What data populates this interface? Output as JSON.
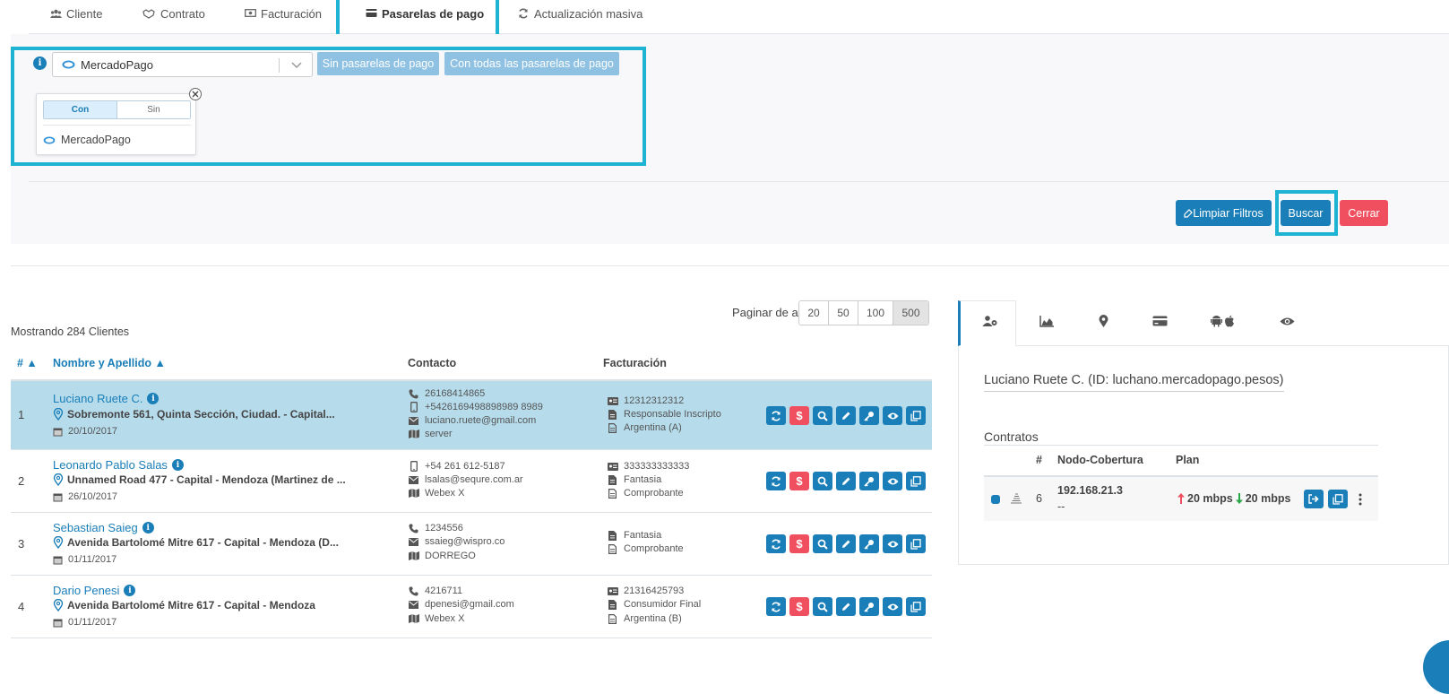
{
  "tabs": [
    {
      "label": "Cliente"
    },
    {
      "label": "Contrato"
    },
    {
      "label": "Facturación"
    },
    {
      "label": "Pasarelas de pago"
    },
    {
      "label": "Actualización masiva"
    }
  ],
  "filter": {
    "selected_gateway": "MercadoPago",
    "btn_without": "Sin pasarelas de pago",
    "btn_all": "Con todas las pasarelas de pago",
    "toggle_on": "Con",
    "toggle_off": "Sin",
    "option": "MercadoPago"
  },
  "actions": {
    "clear": "Limpiar Filtros",
    "search": "Buscar",
    "close": "Cerrar"
  },
  "pagination": {
    "label": "Paginar de a",
    "options": [
      "20",
      "50",
      "100",
      "500"
    ],
    "selected": "500"
  },
  "count_text": "Mostrando 284 Clientes",
  "table": {
    "headers": {
      "num": "# ▲",
      "name": "Nombre y Apellido ▲",
      "contact": "Contacto",
      "billing": "Facturación"
    },
    "rows": [
      {
        "num": "1",
        "name": "Luciano Ruete C.",
        "address": "Sobremonte 561, Quinta Sección, Ciudad. - Capital...",
        "date": "20/10/2017",
        "phone": "26168414865",
        "mobile": "+5426169498898989 8989",
        "email": "luciano.ruete@gmail.com",
        "node": "server",
        "doc": "12312312312",
        "tax": "Responsable Inscripto",
        "invoice": "Argentina (A)"
      },
      {
        "num": "2",
        "name": "Leonardo Pablo Salas",
        "address": "Unnamed Road 477 - Capital - Mendoza (Martinez de ...",
        "date": "26/10/2017",
        "mobile": "+54 261 612-5187",
        "email": "lsalas@sequre.com.ar",
        "node": "Webex X",
        "doc": "333333333333",
        "tax": "Fantasia",
        "invoice": "Comprobante"
      },
      {
        "num": "3",
        "name": "Sebastian Saieg",
        "address": "Avenida Bartolomé Mitre 617 - Capital - Mendoza (D...",
        "date": "01/11/2017",
        "phone": "1234556",
        "email": "ssaieg@wispro.co",
        "node": "DORREGO",
        "tax": "Fantasia",
        "invoice": "Comprobante"
      },
      {
        "num": "4",
        "name": "Dario Penesi",
        "address": "Avenida Bartolomé Mitre 617 - Capital - Mendoza",
        "date": "01/11/2017",
        "phone": "4216711",
        "email": "dpenesi@gmail.com",
        "node": "Webex X",
        "doc": "21316425793",
        "tax": "Consumidor Final",
        "invoice": "Argentina (B)"
      }
    ]
  },
  "panel": {
    "title": "Luciano Ruete C. (ID: luchano.mercadopago.pesos)",
    "contracts_label": "Contratos",
    "headers": {
      "num": "#",
      "node": "Nodo-Cobertura",
      "plan": "Plan"
    },
    "contract": {
      "num": "6",
      "ip": "192.168.21.3",
      "ip_sub": "--",
      "up": "20 mbps",
      "down": "20 mbps"
    }
  },
  "colors": {
    "accent": "#1a7eb8",
    "highlight": "#1eb3d3",
    "danger": "#ef4f5f",
    "selected_row": "#b6dcec"
  }
}
